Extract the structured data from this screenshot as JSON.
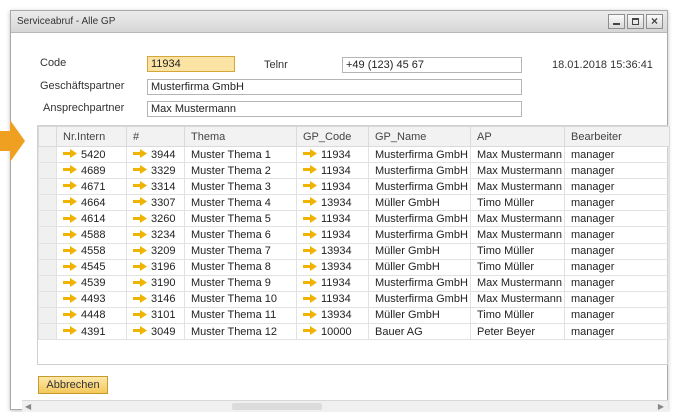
{
  "window": {
    "title": "Serviceabruf - Alle GP",
    "controls": [
      "minimize-icon",
      "maximize-icon",
      "close-icon"
    ]
  },
  "form": {
    "code_label": "Code",
    "code_value": "11934",
    "telnr_label": "Telnr",
    "telnr_value": "+49 (123) 45 67",
    "gp_label": "Geschäftspartner",
    "gp_value": "Musterfirma GmbH",
    "ap_label": "Ansprechpartner",
    "ap_value": "Max Mustermann",
    "datetime": "18.01.2018 15:36:41"
  },
  "table": {
    "headers": [
      "Nr.Intern",
      "#",
      "Thema",
      "GP_Code",
      "GP_Name",
      "AP",
      "Bearbeiter"
    ],
    "rows": [
      [
        "5420",
        "3944",
        "Muster Thema 1",
        "11934",
        "Musterfirma GmbH",
        "Max Mustermann",
        "manager"
      ],
      [
        "4689",
        "3329",
        "Muster Thema 2",
        "11934",
        "Musterfirma GmbH",
        "Max Mustermann",
        "manager"
      ],
      [
        "4671",
        "3314",
        "Muster Thema 3",
        "11934",
        "Musterfirma GmbH",
        "Max Mustermann",
        "manager"
      ],
      [
        "4664",
        "3307",
        "Muster Thema 4",
        "13934",
        "Müller GmbH",
        "Timo Müller",
        "manager"
      ],
      [
        "4614",
        "3260",
        "Muster Thema 5",
        "11934",
        "Musterfirma GmbH",
        "Max Mustermann",
        "manager"
      ],
      [
        "4588",
        "3234",
        "Muster Thema 6",
        "11934",
        "Musterfirma GmbH",
        "Max Mustermann",
        "manager"
      ],
      [
        "4558",
        "3209",
        "Muster Thema 7",
        "13934",
        "Müller GmbH",
        "Timo Müller",
        "manager"
      ],
      [
        "4545",
        "3196",
        "Muster Thema 8",
        "13934",
        "Müller GmbH",
        "Timo Müller",
        "manager"
      ],
      [
        "4539",
        "3190",
        "Muster Thema 9",
        "11934",
        "Musterfirma GmbH",
        "Max Mustermann",
        "manager"
      ],
      [
        "4493",
        "3146",
        "Muster Thema 10",
        "11934",
        "Musterfirma GmbH",
        "Max Mustermann",
        "manager"
      ],
      [
        "4448",
        "3101",
        "Muster Thema 11",
        "13934",
        "Müller GmbH",
        "Timo Müller",
        "manager"
      ],
      [
        "4391",
        "3049",
        "Muster Thema 12",
        "10000",
        "Bauer AG",
        "Peter Beyer",
        "manager"
      ]
    ]
  },
  "buttons": {
    "cancel": "Abbrechen"
  },
  "colors": {
    "accent": "#f4c95d",
    "link_arrow": "#f0b400",
    "big_arrow": "#f0a020"
  }
}
